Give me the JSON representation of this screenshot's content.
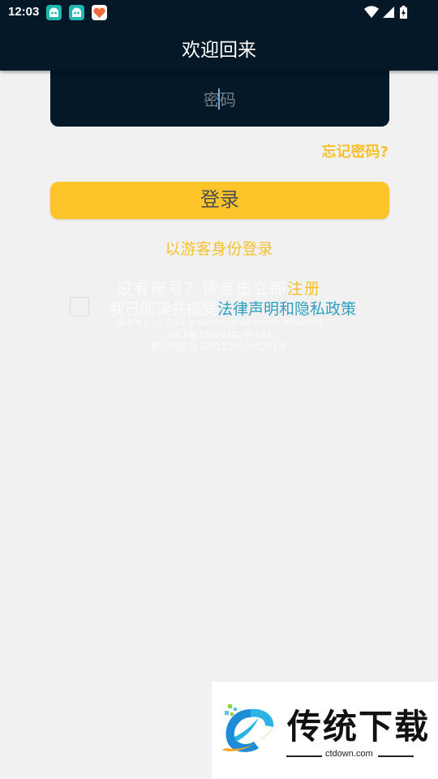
{
  "status_bar": {
    "time": "12:03",
    "notification_icons": [
      "app-icon-teal",
      "app-icon-teal",
      "app-icon-heart"
    ],
    "right_icons": [
      "wifi-icon",
      "signal-icon",
      "battery-charging-icon"
    ]
  },
  "header": {
    "title": "欢迎回来"
  },
  "form": {
    "password_placeholder": "密码",
    "forgot_password": "忘记密码?",
    "login_button": "登录",
    "guest_login": "以游客身份登录"
  },
  "register": {
    "prompt": "没有账号？请点击立即",
    "link": "注册"
  },
  "agreement": {
    "prefix": "我已阅读并接受",
    "link": "法律声明和隐私政策"
  },
  "footer": {
    "version": "版本号：v1.0.14   ©epiroc.cn all rights reserved",
    "icp": "苏ICP备18026282号-17A",
    "police": "苏公网安 注32011305000271号"
  },
  "watermark": {
    "title": "传统下载",
    "url": "ctdown.com"
  },
  "colors": {
    "dark": "#041827",
    "accent": "#fec52a",
    "link": "#2f9ebf"
  }
}
